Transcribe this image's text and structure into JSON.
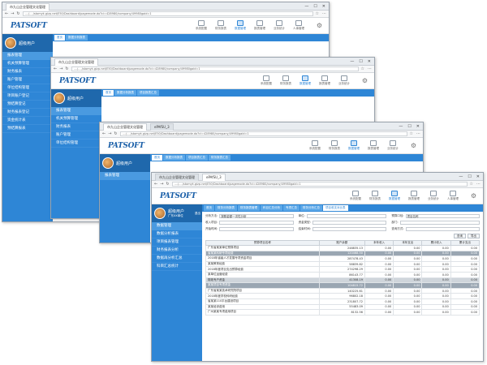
{
  "browser": {
    "tab_title": "ePAfSU_3",
    "url": "..../..../stomyk.gizp.net/E50/Dashboard/pagemode.do?ci=428980/company/49980gaid=1",
    "nav": {
      "back": "←",
      "forward": "→",
      "refresh": "↻"
    },
    "window_controls": {
      "min": "—",
      "max": "☐",
      "close": "✕"
    },
    "first_tab_title": "ePAfSU_3",
    "back_window_tab": "市九山企业管理文化管理"
  },
  "app": {
    "logo": "PATSOFT",
    "modules": [
      "系统配置",
      "财务报表",
      "数据管理",
      "报表管理",
      "业务统计",
      "人事管理"
    ],
    "user_name": "超级用户",
    "user_lines": [
      "广东XX单位",
      "XX部门"
    ],
    "logout": "退出"
  },
  "sidebar_back": {
    "section": "报表管理",
    "items": [
      "机关预算管理",
      "财务报表",
      "账户管理",
      "单位结构管理",
      "项目账户登记",
      "预结算登记",
      "财务报表登记",
      "资金统计表",
      "预结算报表",
      "科目汇总表",
      "对比汇总表"
    ]
  },
  "sidebar_front": {
    "section": "数据管理",
    "items": [
      "数据分析报表",
      "项目报表管理",
      "财务报表分析",
      "数据再分析汇总",
      "科目汇总统计"
    ]
  },
  "crumbs_back": [
    "首页",
    "数据分析报表",
    "项目报表汇总",
    "财务报表汇总"
  ],
  "crumbs_front": [
    "首页",
    "财务分析报表",
    "财务报表管理",
    "科目汇总分析",
    "专项汇总",
    "财务分析汇总",
    "预算收入汇总",
    "项目收支对比表"
  ],
  "filters": [
    {
      "label": "分析方法:",
      "value": "按照金额一次性分析"
    },
    {
      "label": "单位:",
      "value": ""
    },
    {
      "label": "预算口径:",
      "value": "项目名称"
    },
    {
      "label": "收入项目:",
      "value": ""
    },
    {
      "label": "资金类型:",
      "value": ""
    },
    {
      "label": "部门:",
      "value": ""
    },
    {
      "label": "开始时间:",
      "value": ""
    },
    {
      "label": "结束时间:",
      "value": ""
    },
    {
      "label": "查询方式:",
      "value": ""
    }
  ],
  "buttons": [
    "查询",
    "导出"
  ],
  "table": {
    "headers": [
      "预算项目名称",
      "账户余额",
      "本年收入",
      "本年支出",
      "累计收入",
      "累计支出"
    ],
    "rows": [
      {
        "name": "广东省某某单位预算项目",
        "v1": "248835.13",
        "v2": "0.00",
        "v3": "0.00",
        "v4": "0.00",
        "v5": "0.00",
        "style": ""
      },
      {
        "name": "省某某科研专项经费",
        "v1": "120468.50",
        "v2": "0.00",
        "v3": "0.00",
        "v4": "0.00",
        "v5": "0.00",
        "style": "dk"
      },
      {
        "name": "2018年省级人才发展专项资金项目",
        "v1": "287478.43",
        "v2": "0.00",
        "v3": "0.00",
        "v4": "0.00",
        "v5": "0.00",
        "style": ""
      },
      {
        "name": "某某教育经费",
        "v1": "58839.82",
        "v2": "0.00",
        "v3": "0.00",
        "v4": "0.00",
        "v5": "0.00",
        "style": ""
      },
      {
        "name": "2018年度项目支出预算经费",
        "v1": "274298.29",
        "v2": "0.00",
        "v3": "0.00",
        "v4": "0.00",
        "v5": "0.00",
        "style": ""
      },
      {
        "name": "某单位运营经费",
        "v1": "86143.77",
        "v2": "0.00",
        "v3": "0.00",
        "v4": "0.00",
        "v5": "0.00",
        "style": ""
      },
      {
        "name": "财政专户资金",
        "v1": "41308.19",
        "v2": "0.00",
        "v3": "0.00",
        "v4": "0.00",
        "v5": "0.00",
        "style": "hl"
      },
      {
        "name": "某某项目专项资金",
        "v1": "104815.72",
        "v2": "0.00",
        "v3": "0.00",
        "v4": "0.00",
        "v5": "0.00",
        "style": "dk"
      },
      {
        "name": "广东省某某技术研究院项目",
        "v1": "140225.61",
        "v2": "0.00",
        "v3": "0.00",
        "v4": "0.00",
        "v5": "0.00",
        "style": ""
      },
      {
        "name": "2018年度学校科研经费",
        "v1": "96802.18",
        "v2": "0.00",
        "v3": "0.00",
        "v4": "0.00",
        "v5": "0.00",
        "style": ""
      },
      {
        "name": "省某某110平台建设项目",
        "v1": "231807.72",
        "v2": "0.00",
        "v3": "0.00",
        "v4": "0.00",
        "v5": "0.00",
        "style": ""
      },
      {
        "name": "某某培训费用",
        "v1": "55483.09",
        "v2": "0.00",
        "v3": "0.00",
        "v4": "0.00",
        "v5": "0.00",
        "style": ""
      },
      {
        "name": "广州某某专项费用项目",
        "v1": "8132.56",
        "v2": "0.00",
        "v3": "0.00",
        "v4": "0.00",
        "v5": "0.00",
        "style": ""
      }
    ]
  }
}
